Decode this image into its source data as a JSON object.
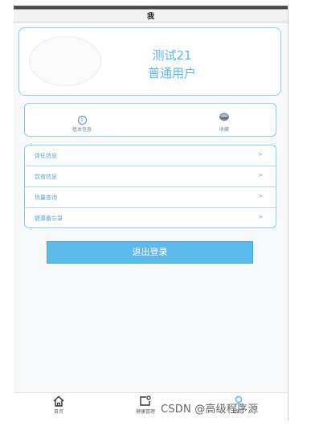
{
  "header": {
    "title": "我"
  },
  "profile": {
    "name": "测试21",
    "role": "普通用户"
  },
  "quick_actions": [
    {
      "label": "基本信息",
      "icon": "info-icon"
    },
    {
      "label": "收藏",
      "icon": "favorite-icon"
    }
  ],
  "menu": {
    "items": [
      {
        "label": "体征信息",
        "chevron": ">"
      },
      {
        "label": "饮食信息",
        "chevron": ">"
      },
      {
        "label": "热量查询",
        "chevron": ">"
      },
      {
        "label": "健康备忘录",
        "chevron": ">"
      }
    ]
  },
  "logout_label": "退出登录",
  "tabbar": {
    "items": [
      {
        "label": "首页",
        "icon": "home-icon"
      },
      {
        "label": "健康管理",
        "icon": "health-icon"
      },
      {
        "label": "我的",
        "icon": "user-icon"
      }
    ]
  },
  "watermark": "CSDN @高级程序源",
  "colors": {
    "accent": "#5cb9e9",
    "card_border": "#8fcbea",
    "text_blue": "#5bb7e6"
  }
}
